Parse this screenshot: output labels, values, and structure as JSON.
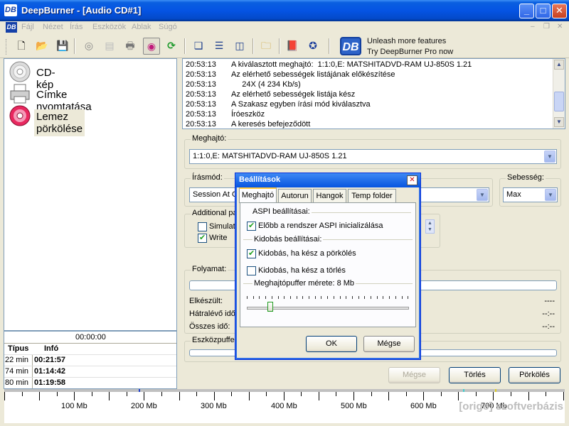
{
  "window": {
    "title": "DeepBurner - [Audio CD#1]",
    "logo": "DB"
  },
  "menu": [
    "Fájl",
    "Nézet",
    "Írás",
    "Eszközök",
    "Ablak",
    "Súgó"
  ],
  "promo": {
    "line1": "Unleash more features",
    "line2": "Try DeepBurner Pro now",
    "logo": "DB"
  },
  "nav": [
    {
      "label": "CD-kép",
      "icon": "cd-image-icon"
    },
    {
      "label": "Címke nyomtatása",
      "icon": "printer-icon"
    },
    {
      "label": "Lemez pörkölése",
      "icon": "burn-disc-icon"
    }
  ],
  "info": {
    "time": "00:00:00",
    "headers": [
      "Típus",
      "Infó"
    ],
    "rows": [
      {
        "type": "22 min",
        "info": "00:21:57"
      },
      {
        "type": "74 min",
        "info": "01:14:42"
      },
      {
        "type": "80 min",
        "info": "01:19:58"
      }
    ]
  },
  "log": [
    {
      "time": "20:53:13",
      "msg": "A kiválasztott meghajtó:  1:1:0,E: MATSHITADVD-RAM UJ-850S 1.21"
    },
    {
      "time": "20:53:13",
      "msg": "Az elérhető sebességek listájának előkészítése"
    },
    {
      "time": "20:53:13",
      "msg": "     24X (4 234 Kb/s)"
    },
    {
      "time": "20:53:13",
      "msg": "Az elérhető sebességek listája kész"
    },
    {
      "time": "20:53:13",
      "msg": "A Szakasz egyben írási mód kiválasztva"
    },
    {
      "time": "20:53:13",
      "msg": "Íróeszköz"
    },
    {
      "time": "20:53:13",
      "msg": "A keresés befejeződött"
    }
  ],
  "drive": {
    "label": "Meghajtó:",
    "value": "1:1:0,E: MATSHITADVD-RAM UJ-850S 1.21"
  },
  "write_mode": {
    "label": "Írásmód:",
    "value": "Session At O"
  },
  "speed": {
    "label": "Sebesség:",
    "value": "Max"
  },
  "additional": {
    "label": "Additional pa",
    "simulate": "Simulati",
    "write": "Write"
  },
  "progress": {
    "label": "Folyamat:",
    "done_label": "Elkészült:",
    "done_val": "----",
    "remaining_label": "Hátralévő idő",
    "remaining_val": "--:--",
    "total_label": "Összes idő:",
    "total_val": "--:--"
  },
  "device_buffer": {
    "label": "Eszközpuffe"
  },
  "buttons": {
    "cancel": "Mégse",
    "erase": "Törlés",
    "burn": "Pörkölés"
  },
  "ruler": [
    "100 Mb",
    "200 Mb",
    "300 Mb",
    "400 Mb",
    "500 Mb",
    "600 Mb",
    "700 Mb"
  ],
  "watermark": "[origo] szoftverbázis",
  "dialog": {
    "title": "Beállítások",
    "tabs": [
      "Meghajtó",
      "Autorun",
      "Hangok",
      "Temp folder"
    ],
    "aspi_group": "ASPI beállításai:",
    "aspi_init": "Előbb a rendszer ASPI inicializálása",
    "eject_group": "Kidobás beállításai:",
    "eject_burn": "Kidobás, ha kész a pörkölés",
    "eject_erase": "Kidobás, ha kész a törlés",
    "buffer_label": "Meghajtópuffer mérete: 8 Mb",
    "ok": "OK",
    "cancel": "Mégse"
  }
}
